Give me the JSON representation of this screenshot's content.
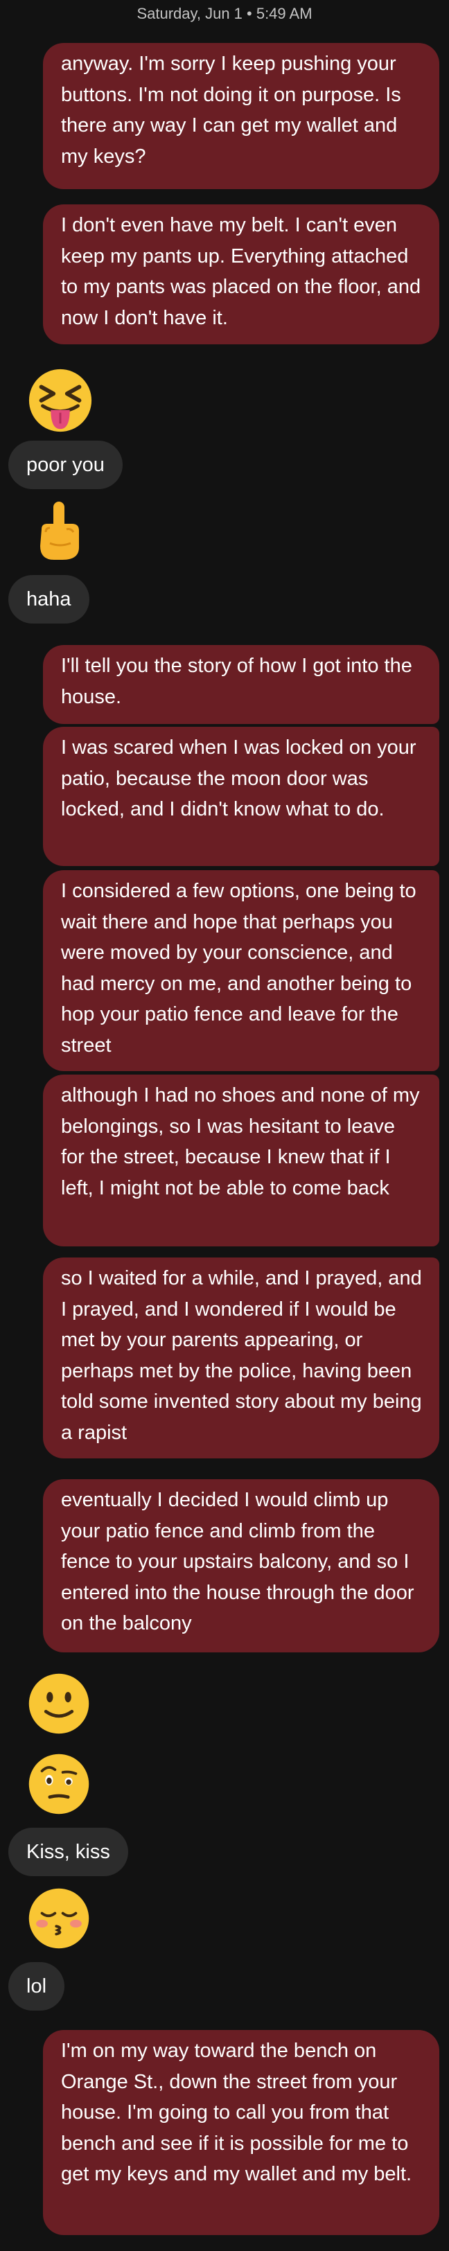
{
  "header": {
    "timestamp": "Saturday, Jun 1 • 5:49 AM"
  },
  "messages": {
    "m1": "anyway. I'm sorry I keep pushing your buttons. I'm not doing it on purpose. Is there any way I can get my wallet and my keys?",
    "m2": "I don't even have my belt. I can't even keep my pants up. Everything attached to my pants was placed on the floor, and now I don't have it.",
    "r1_emoji": "squinting-face-with-tongue",
    "r1": "poor you",
    "r2_emoji": "middle-finger",
    "r2": "haha",
    "m3": "I'll tell you the story of how I got into the house.",
    "m4": "I was scared when I was locked on your patio, because the moon door was locked, and I didn't know what to do.",
    "m5": "I considered a few options, one being to wait there and hope that perhaps you were moved by your conscience, and had mercy on me, and another being to hop your patio fence and leave for the street",
    "m6": "although I had no shoes and none of my belongings, so I was hesitant to leave for the street, because I knew that if I left, I might not be able to come back",
    "m7": "so I waited for a while, and I prayed, and I prayed, and I wondered if I would be met by your parents appearing, or perhaps met by the police, having been told some invented story about my being a rapist",
    "m8": "eventually I decided I would climb up your patio fence and climb from the fence to your upstairs balcony, and so I entered into the house through the door on the balcony",
    "r3_emoji": "slightly-smiling-face",
    "r4_emoji": "face-with-raised-eyebrow",
    "r4": "Kiss, kiss",
    "r5_emoji": "kissing-face-with-closed-eyes",
    "r5": "lol",
    "m9": "I'm on my way toward the bench on Orange St., down the street from your house. I'm going to call you from that bench and see if it is possible for me to get my keys and my wallet and my belt."
  },
  "colors": {
    "background": "#121212",
    "outgoing_bubble": "#6a1e24",
    "incoming_bubble": "#2c2c2c",
    "text": "#ffffff",
    "timestamp": "#c4c4c4"
  }
}
